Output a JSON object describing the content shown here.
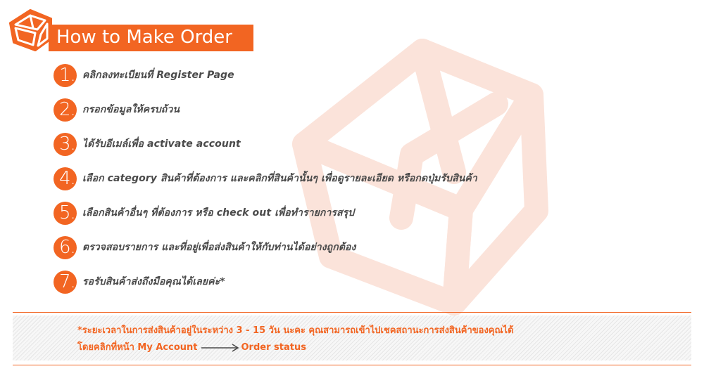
{
  "header": {
    "title": "How to Make Order",
    "logo_icon": "box-icon",
    "accent_color": "#f26522"
  },
  "steps": [
    {
      "number": "1.",
      "text": "คลิกลงทะเบียนที่   Register Page"
    },
    {
      "number": "2.",
      "text": "กรอกข้อมูลให้ครบถ้วน"
    },
    {
      "number": "3.",
      "text": "ได้รับอีเมล์เพื่อ  activate  account"
    },
    {
      "number": "4.",
      "text": "เลือก  category  สินค้าที่ต้องการ  และคลิกที่สินค้านั้นๆ  เพื่อดูรายละเอียด  หรือกดปุ่มรับสินค้า"
    },
    {
      "number": "5.",
      "text": "เลือกสินค้าอื่นๆ  ที่ต้องการ  หรือ  check  out  เพื่อทำรายการสรุป"
    },
    {
      "number": "6.",
      "text": "ตรวจสอบรายการ  และที่อยู่เพื่อส่งสินค้าให้กับท่านได้อย่างถูกต้อง"
    },
    {
      "number": "7.",
      "text": "รอรับสินค้าส่งถึงมือคุณได้เลยค่ะ*"
    }
  ],
  "note": {
    "line1": "*ระยะเวลาในการส่งสินค้าอยู่ในระหว่าง  3  -  15  วัน  นะคะ  คุณสามารถเข้าไปเชคสถานะการส่งสินค้าของคุณได้",
    "line2_prefix": "โดยคลิกที่หน้า  My  Account",
    "arrow_icon": "arrow-right-icon",
    "line2_suffix": "Order  status"
  }
}
